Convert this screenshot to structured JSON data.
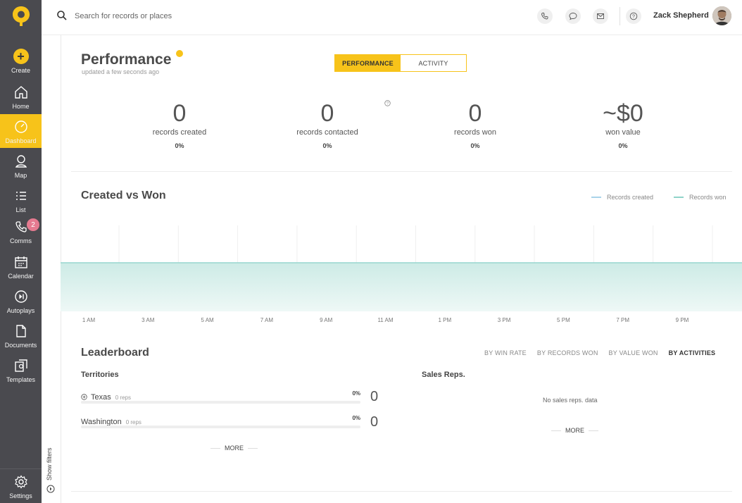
{
  "sidebar": {
    "create_label": "Create",
    "items": [
      {
        "label": "Home"
      },
      {
        "label": "Dashboard"
      },
      {
        "label": "Map"
      },
      {
        "label": "List"
      },
      {
        "label": "Comms",
        "badge": "2"
      },
      {
        "label": "Calendar"
      },
      {
        "label": "Autoplays"
      },
      {
        "label": "Documents"
      },
      {
        "label": "Templates"
      }
    ],
    "settings_label": "Settings",
    "active": "Dashboard",
    "accent_color": "#f7c31a"
  },
  "filters": {
    "label": "Show filters"
  },
  "topbar": {
    "search_placeholder": "Search for records or places",
    "user_name": "Zack Shepherd"
  },
  "header": {
    "title": "Performance",
    "updated": "updated a few seconds ago",
    "toggle": [
      "PERFORMANCE",
      "ACTIVITY"
    ]
  },
  "stats": [
    {
      "value": "0",
      "label": "records created",
      "pct": "0%"
    },
    {
      "value": "0",
      "label": "records contacted",
      "pct": "0%"
    },
    {
      "value": "0",
      "label": "records won",
      "pct": "0%"
    },
    {
      "value": "~$0",
      "label": "won value",
      "pct": "0%"
    }
  ],
  "chart": {
    "title": "Created vs Won",
    "legend": [
      {
        "name": "Records created",
        "color": "#a9d3ea"
      },
      {
        "name": "Records won",
        "color": "#8fd3c9"
      }
    ],
    "x_labels": [
      "1 AM",
      "3 AM",
      "5 AM",
      "7 AM",
      "9 AM",
      "11 AM",
      "1 PM",
      "3 PM",
      "5 PM",
      "7 PM",
      "9 PM"
    ]
  },
  "chart_data": {
    "type": "area",
    "title": "Created vs Won",
    "categories": [
      "1 AM",
      "3 AM",
      "5 AM",
      "7 AM",
      "9 AM",
      "11 AM",
      "1 PM",
      "3 PM",
      "5 PM",
      "7 PM",
      "9 PM"
    ],
    "series": [
      {
        "name": "Records created",
        "values": [
          0,
          0,
          0,
          0,
          0,
          0,
          0,
          0,
          0,
          0,
          0
        ]
      },
      {
        "name": "Records won",
        "values": [
          0,
          0,
          0,
          0,
          0,
          0,
          0,
          0,
          0,
          0,
          0
        ]
      }
    ],
    "legend_position": "top-right",
    "grid": true
  },
  "leaderboard": {
    "title": "Leaderboard",
    "tabs": [
      "BY WIN RATE",
      "BY RECORDS WON",
      "BY VALUE WON",
      "BY ACTIVITIES"
    ],
    "active_tab": "BY ACTIVITIES",
    "territories_title": "Territories",
    "territories": [
      {
        "name": "Texas",
        "reps": "0 reps",
        "pct": "0%",
        "count": "0",
        "fill": 0
      },
      {
        "name": "Washington",
        "reps": "0 reps",
        "pct": "0%",
        "count": "0",
        "fill": 0
      }
    ],
    "reps_title": "Sales Reps.",
    "no_reps": "No sales reps. data",
    "more_label": "MORE"
  }
}
